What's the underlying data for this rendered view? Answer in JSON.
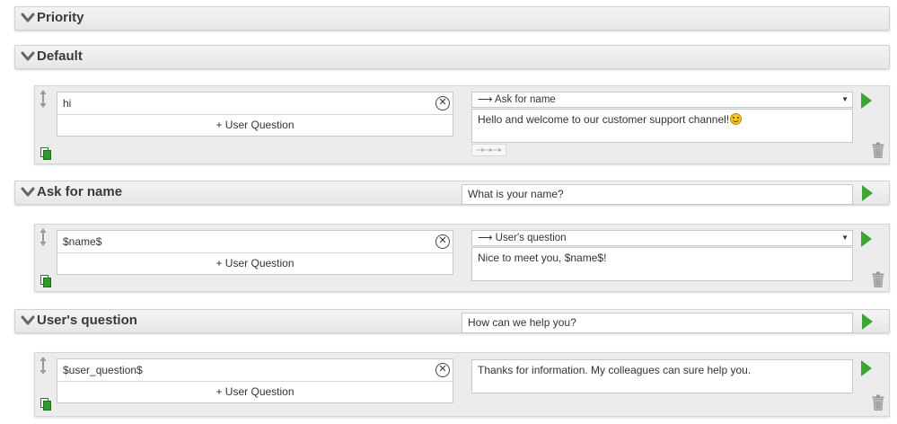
{
  "sections": {
    "priority": {
      "title": "Priority"
    },
    "default": {
      "title": "Default"
    },
    "ask_for_name": {
      "title": "Ask for name",
      "prompt": "What is your name?"
    },
    "users_question": {
      "title": "User's question",
      "prompt": "How can we help you?"
    }
  },
  "rules": [
    {
      "question": "hi",
      "add_question": "+ User Question",
      "target": "⟶ Ask for name",
      "answer": "Hello and welcome to our customer support channel!"
    },
    {
      "question": "$name$",
      "add_question": "+ User Question",
      "target": "⟶ User's question",
      "answer": "Nice to meet you, $name$!"
    },
    {
      "question": "$user_question$",
      "add_question": "+ User Question",
      "answer": "Thanks for information. My colleagues can sure help you."
    }
  ],
  "icons": {
    "chevron": "chevron-down-icon",
    "clear": "clear-circle-icon",
    "play": "play-icon",
    "trash": "trash-icon",
    "drag": "drag-handle-icon",
    "copy": "copy-icon",
    "chain": "chain-arrows-icon",
    "emoji": "smiley-emoji-icon"
  },
  "colors": {
    "play_green": "#3ca534",
    "copy_green": "#2e9a2e",
    "header_bg": "#eaeaea",
    "rule_bg": "#ececec"
  }
}
